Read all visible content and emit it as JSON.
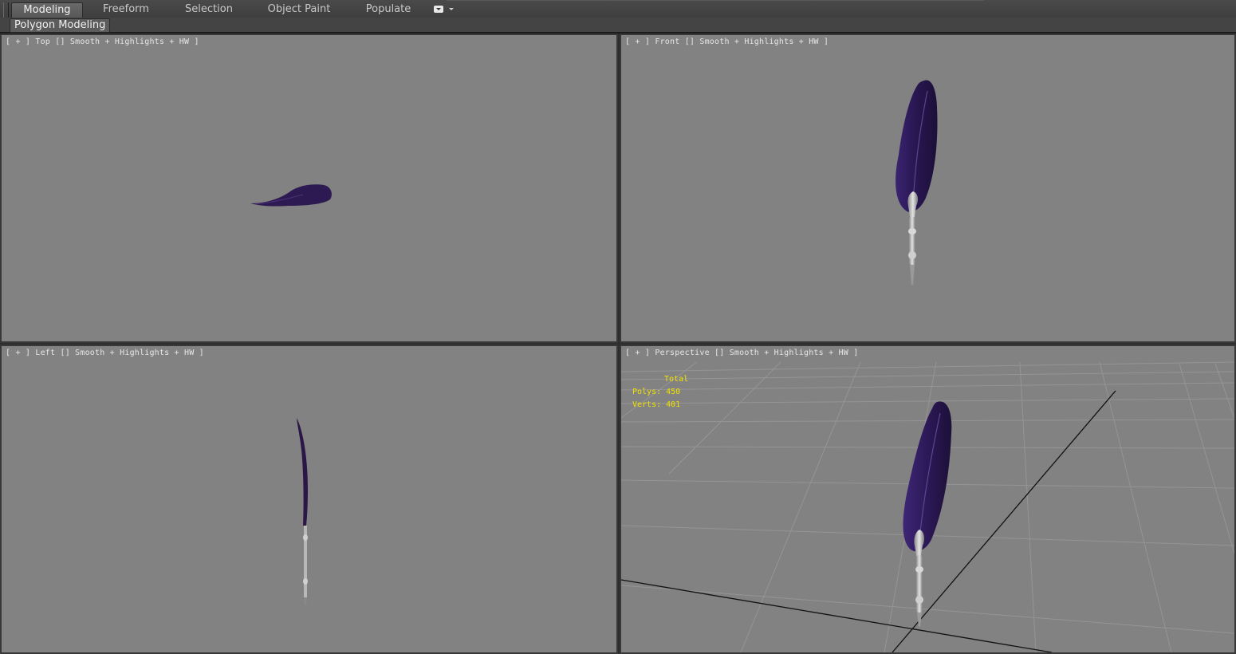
{
  "ribbon": {
    "tabs": [
      {
        "label": "Modeling",
        "active": true
      },
      {
        "label": "Freeform",
        "active": false
      },
      {
        "label": "Selection",
        "active": false
      },
      {
        "label": "Object Paint",
        "active": false
      },
      {
        "label": "Populate",
        "active": false
      }
    ],
    "options_icon": "ribbon-options-icon",
    "panel_label": "Polygon Modeling"
  },
  "viewports": {
    "top": {
      "plus": "+",
      "view": "Top",
      "shading": "Smooth + Highlights + HW"
    },
    "front": {
      "plus": "+",
      "view": "Front",
      "shading": "Smooth + Highlights + HW"
    },
    "left": {
      "plus": "+",
      "view": "Left",
      "shading": "Smooth + Highlights + HW"
    },
    "perspective": {
      "plus": "+",
      "view": "Perspective",
      "shading": "Smooth + Highlights + HW"
    }
  },
  "statistics": {
    "header": "Total",
    "polys": "Polys: 450",
    "verts": "Verts: 401"
  },
  "colors": {
    "viewport_bg": "#828282",
    "feather": "#2e1a52",
    "nib": "#c8c8c8",
    "stats_text": "#f2e200"
  }
}
